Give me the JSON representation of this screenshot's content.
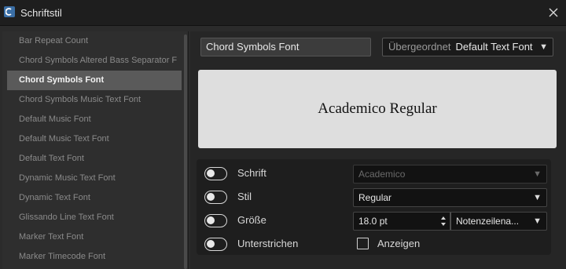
{
  "window": {
    "title": "Schriftstil",
    "close_icon": "close-icon",
    "app_icon": "cubase-logo-icon"
  },
  "sidebar": {
    "items": [
      {
        "label": "Bar Repeat Count"
      },
      {
        "label": "Chord Symbols Altered Bass Separator F"
      },
      {
        "label": "Chord Symbols Font"
      },
      {
        "label": "Chord Symbols Music Text Font"
      },
      {
        "label": "Default Music Font"
      },
      {
        "label": "Default Music Text Font"
      },
      {
        "label": "Default Text Font"
      },
      {
        "label": "Dynamic Music Text Font"
      },
      {
        "label": "Dynamic Text Font"
      },
      {
        "label": "Glissando Line Text Font"
      },
      {
        "label": "Marker Text Font"
      },
      {
        "label": "Marker Timecode Font"
      }
    ],
    "selected_label": "Chord Symbols Font"
  },
  "header": {
    "name_value": "Chord Symbols Font",
    "parent_label": "Übergeordnet",
    "parent_value": "Default Text Font"
  },
  "preview": {
    "text": "Academico Regular"
  },
  "properties": {
    "font": {
      "label": "Schrift",
      "value": "Academico",
      "enabled": false
    },
    "style": {
      "label": "Stil",
      "value": "Regular",
      "enabled": true
    },
    "size": {
      "label": "Größe",
      "value": "18.0 pt",
      "unit": "Notenzeilena...",
      "enabled": true
    },
    "underline": {
      "label": "Unterstrichen",
      "checkbox_label": "Anzeigen",
      "checked": false
    }
  },
  "colors": {
    "background": "#2b2b2b",
    "selected_item": "#5a5a5a",
    "preview_bg": "#dedede"
  }
}
